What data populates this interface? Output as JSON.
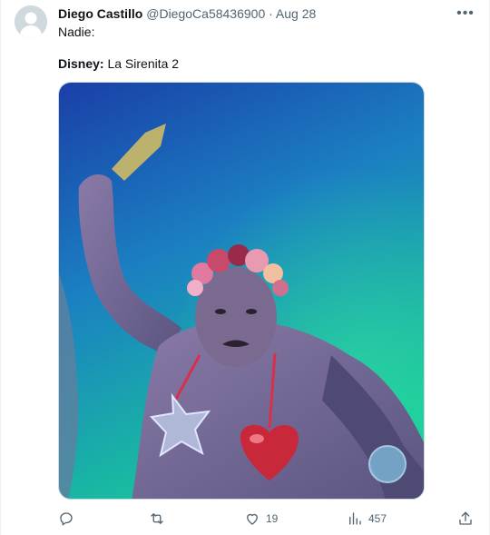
{
  "tweet": {
    "author_name": "Diego Castillo",
    "author_handle": "@DiegoCa58436900",
    "separator": "·",
    "date": "Aug 28",
    "more_label": "•••",
    "line1": "Nadie:",
    "line2_prefix": "Disney:",
    "line2_rest": " La Sirenita 2"
  },
  "actions": {
    "reply_count": "",
    "retweet_count": "",
    "like_count": "19",
    "view_count": "457"
  },
  "icons": {
    "avatar": "default-avatar-icon",
    "more": "more-options-icon",
    "reply": "reply-icon",
    "retweet": "retweet-icon",
    "like": "heart-icon",
    "views": "views-chart-icon",
    "share": "share-icon"
  },
  "colors": {
    "text_primary": "#0f1419",
    "text_secondary": "#536471",
    "border": "#cfd9de"
  }
}
